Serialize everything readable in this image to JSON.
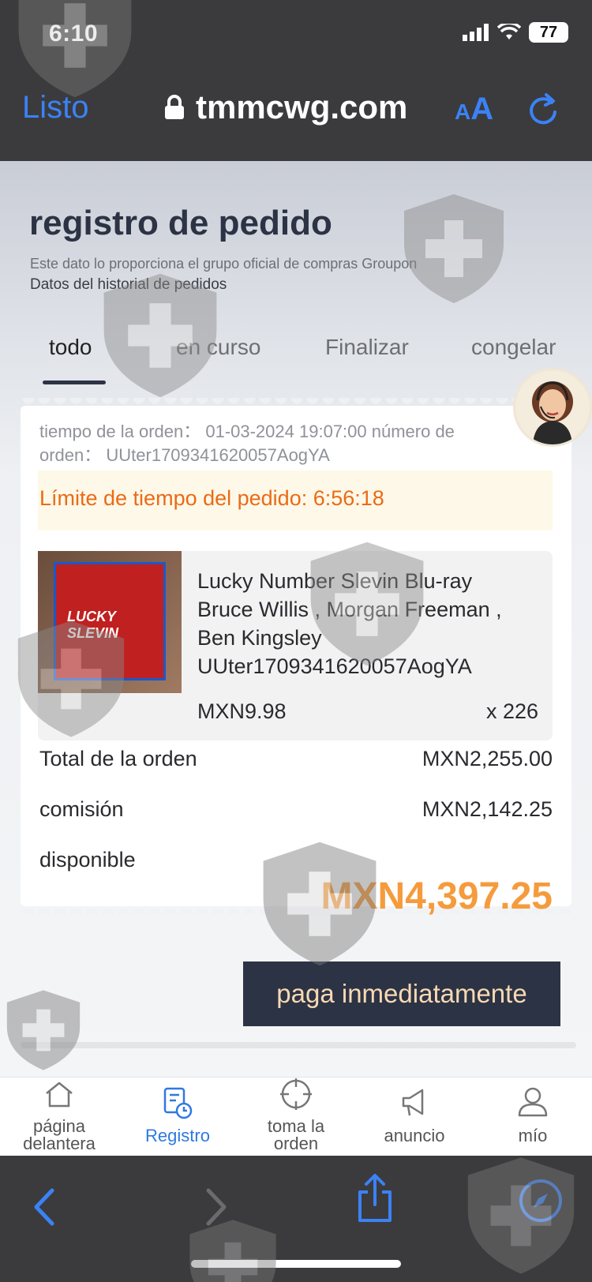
{
  "status_bar": {
    "time": "6:10",
    "battery": "77"
  },
  "browser": {
    "done_label": "Listo",
    "domain": "tmmcwg.com",
    "text_size_label_small": "A",
    "text_size_label_big": "A"
  },
  "page": {
    "title": "registro de pedido",
    "subtitle_1": "Este dato lo proporciona el grupo oficial de compras Groupon",
    "subtitle_2": "Datos del historial de pedidos",
    "tabs": [
      {
        "label": "todo",
        "active": true
      },
      {
        "label": "en curso",
        "active": false
      },
      {
        "label": "Finalizar",
        "active": false
      },
      {
        "label": "congelar",
        "active": false
      }
    ]
  },
  "order": {
    "meta_line_1": "tiempo de la orden： 01-03-2024 19:07:00 número de",
    "meta_line_2": "orden： UUter1709341620057AogYA",
    "time_limit": "Límite de tiempo del pedido: 6:56:18",
    "item": {
      "cover_text": "LUCKY SLEVIN",
      "title_lines": [
        "Lucky Number Slevin Blu-ray",
        "Bruce Willis , Morgan Freeman ,",
        "Ben Kingsley",
        "UUter1709341620057AogYA"
      ],
      "price": "MXN9.98",
      "quantity": "x 226"
    },
    "total_label": "Total de la orden",
    "total_value": "MXN2,255.00",
    "commission_label": "comisión",
    "commission_value": "MXN2,142.25",
    "available_label": "disponible",
    "available_value": "MXN4,397.25",
    "pay_button": "paga inmediatamente"
  },
  "bottom_nav": [
    {
      "label_1": "página",
      "label_2": "delantera",
      "icon": "home-icon",
      "active": false
    },
    {
      "label_1": "Registro",
      "label_2": "",
      "icon": "record-icon",
      "active": true
    },
    {
      "label_1": "toma la",
      "label_2": "orden",
      "icon": "target-icon",
      "active": false
    },
    {
      "label_1": "anuncio",
      "label_2": "",
      "icon": "megaphone-icon",
      "active": false
    },
    {
      "label_1": "mío",
      "label_2": "",
      "icon": "user-icon",
      "active": false
    }
  ],
  "colors": {
    "accent_blue": "#3b82f6",
    "nav_active": "#2f78e3",
    "dark_navy": "#2c3344",
    "orange_limit": "#ea6b16",
    "orange_amount": "#f59b3c"
  }
}
